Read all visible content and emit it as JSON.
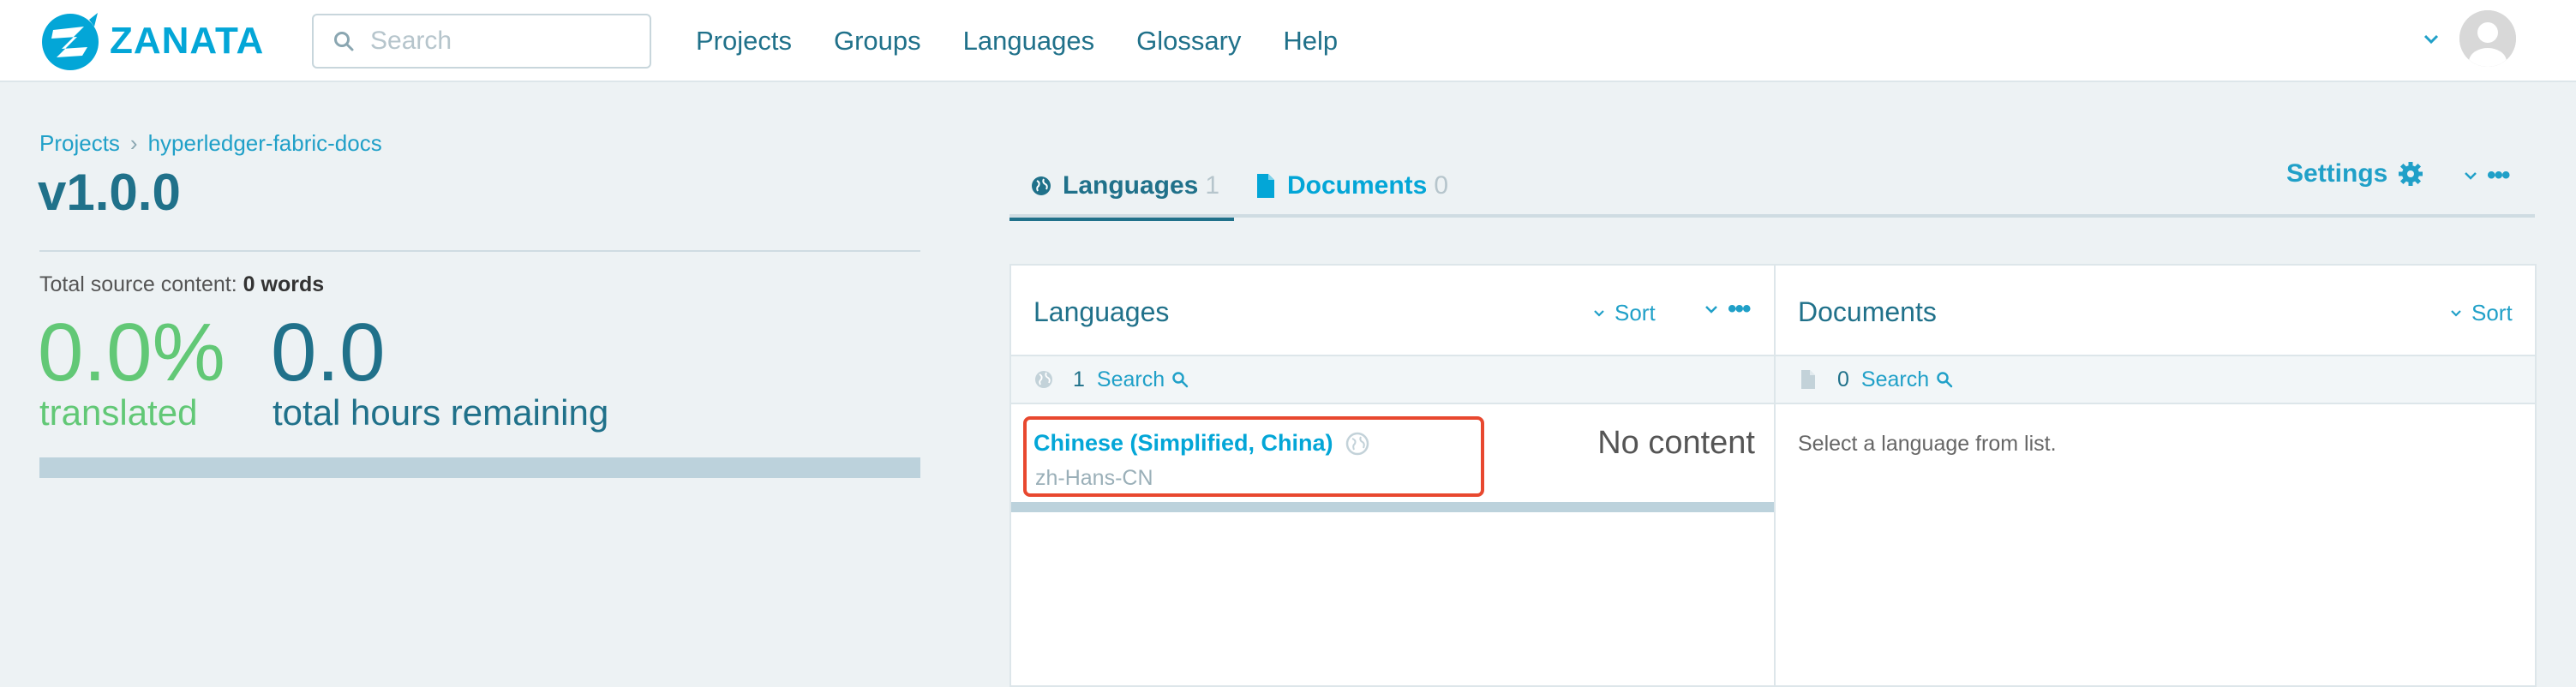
{
  "nav": {
    "brand": "ZANATA",
    "search_placeholder": "Search",
    "links": [
      "Projects",
      "Groups",
      "Languages",
      "Glossary",
      "Help"
    ]
  },
  "breadcrumb": {
    "root": "Projects",
    "separator": "›",
    "project": "hyperledger-fabric-docs"
  },
  "version": {
    "title": "v1.0.0",
    "total_source_label": "Total source content:",
    "total_source_value": "0 words",
    "percent_translated": "0.0%",
    "translated_label": "translated",
    "hours_remaining": "0.0",
    "hours_label": "total hours remaining"
  },
  "tabs": {
    "languages": {
      "label": "Languages",
      "count": "1"
    },
    "documents": {
      "label": "Documents",
      "count": "0"
    },
    "settings": "Settings"
  },
  "languages_panel": {
    "title": "Languages",
    "sort_label": "Sort",
    "count": "1",
    "search_label": "Search",
    "items": [
      {
        "name": "Chinese (Simplified, China)",
        "code": "zh-Hans-CN",
        "status": "No content"
      }
    ]
  },
  "documents_panel": {
    "title": "Documents",
    "sort_label": "Sort",
    "count": "0",
    "search_label": "Search",
    "hint": "Select a language from list."
  },
  "colors": {
    "brand": "#03a6d7",
    "text_dark": "#20718a",
    "translated_green": "#62c876",
    "highlight": "#e8482f",
    "background": "#edf2f4"
  },
  "icons": [
    "zanata-logo-icon",
    "search-icon",
    "chevron-down-icon",
    "avatar-icon",
    "globe-icon",
    "document-icon",
    "gear-icon",
    "more-icon"
  ]
}
